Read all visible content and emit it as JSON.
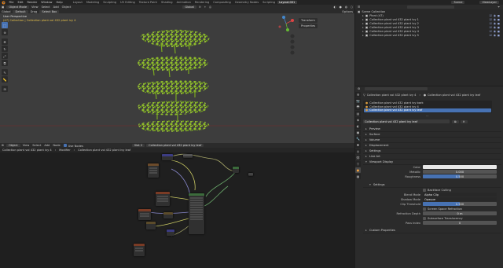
{
  "app": {
    "menu": [
      "File",
      "Edit",
      "Render",
      "Window",
      "Help"
    ],
    "workspaces": [
      "Layout",
      "Modeling",
      "Sculpting",
      "UV Editing",
      "Texture Paint",
      "Shading",
      "Animation",
      "Rendering",
      "Compositing",
      "Geometry Nodes",
      "Scripting",
      "Layout.001"
    ],
    "active_workspace_index": 11,
    "scene_label": "Scene",
    "view_layer_label": "ViewLayer"
  },
  "viewport": {
    "header": {
      "mode": "Object Mode",
      "menus": [
        "View",
        "Select",
        "Add",
        "Object"
      ],
      "orientation_label": "Global",
      "orientation_value": "Global",
      "pivot": "Default",
      "drag": "Drag",
      "select": "Select Box",
      "transform": "Options"
    },
    "info_line1": "User Perspective",
    "info_line2": "(47) Collection | Collection plant vol 432 plant ivy 4",
    "sidebar_tabs": [
      "Transform",
      "Properties"
    ],
    "tools": [
      "select",
      "cursor",
      "move",
      "rotate",
      "scale",
      "transform",
      "annotate",
      "measure",
      "add"
    ]
  },
  "node_editor": {
    "header": {
      "editor": "Object",
      "menus": [
        "View",
        "Select",
        "Add",
        "Node"
      ],
      "use_nodes": "Use Nodes",
      "slot": "Slot 2",
      "material": "Collection plant vol 432 plant ivy leaf"
    },
    "breadcrumb": [
      "Collection plant vol 432 plant ivy 4",
      "Modifier",
      "Collection plant vol 432 plant ivy leaf"
    ]
  },
  "outliner": {
    "title": "Scene Collection",
    "items": [
      {
        "label": "Plant (47)",
        "indent": 1
      },
      {
        "label": "Collection plant vol 432 plant ivy 1",
        "indent": 1
      },
      {
        "label": "Collection plant vol 432 plant ivy 2",
        "indent": 1
      },
      {
        "label": "Collection plant vol 432 plant ivy 3",
        "indent": 1
      },
      {
        "label": "Collection plant vol 432 plant ivy 4",
        "indent": 1
      },
      {
        "label": "Collection plant vol 432 plant ivy 5",
        "indent": 1
      }
    ]
  },
  "properties": {
    "object_name": "Collection plant vol 432 plant ivy 4",
    "material_breadcrumb": "Collection plant vol 432 plant ivy leaf",
    "slots": [
      "Collection plant vol 432 plant ivy bark",
      "Collection plant vol 432 plant ivy 4",
      "Collection plant vol 432 plant ivy leaf"
    ],
    "selected_slot_index": 2,
    "material_name": "Collection plant vol 432 plant ivy leaf",
    "sections": [
      "Preview",
      "Surface",
      "Volume",
      "Displacement",
      "Settings",
      "Line Art",
      "Viewport Display"
    ],
    "viewport_display": {
      "color_label": "Color",
      "metallic_label": "Metallic",
      "metallic_value": "0.000",
      "roughness_label": "Roughness",
      "roughness_value": "0.500",
      "roughness_fraction": 0.5
    },
    "settings": {
      "title": "Settings",
      "backface_culling": "Backface Culling",
      "blend_mode_label": "Blend Mode",
      "blend_mode_value": "Alpha Clip",
      "shadow_mode_label": "Shadow Mode",
      "shadow_mode_value": "Opaque",
      "clip_threshold_label": "Clip Threshold",
      "clip_threshold_value": "0.500",
      "clip_threshold_fraction": 0.5,
      "screen_space_refraction": "Screen Space Refraction",
      "refraction_depth_label": "Refraction Depth",
      "refraction_depth_value": "0 m",
      "subsurface_translucency": "Subsurface Translucency",
      "pass_index_label": "Pass Index",
      "pass_index_value": "0"
    },
    "custom_properties": "Custom Properties"
  },
  "colors": {
    "accent": "#4772b3",
    "viewport_bg": "#3d3d3d",
    "ivy_green": "#8fbf2a",
    "info_yellow": "#e8c24a"
  }
}
